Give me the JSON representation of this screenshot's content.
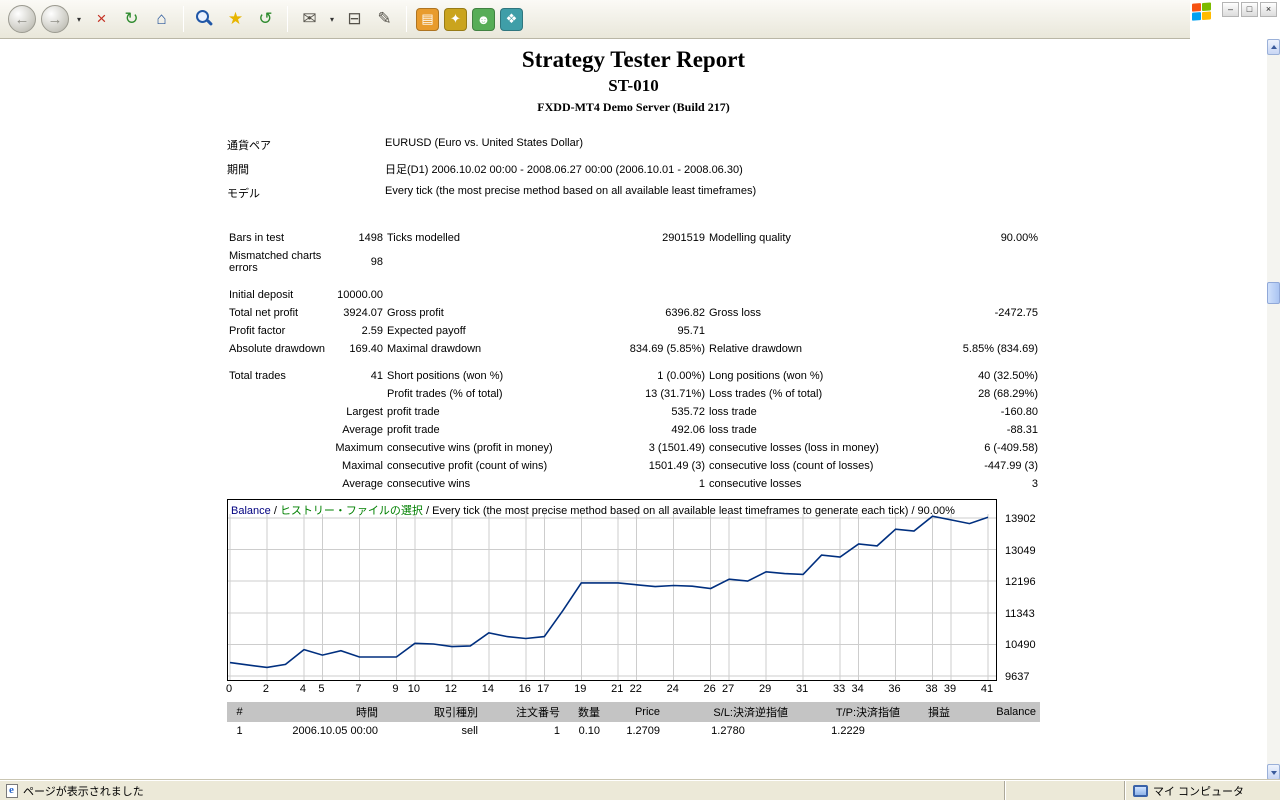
{
  "browser": {
    "toolbar": [
      {
        "name": "back-button",
        "icon": "back-icon",
        "glyph": "←",
        "style": "st-round"
      },
      {
        "name": "forward-button",
        "icon": "forward-icon",
        "glyph": "→",
        "style": "st-round"
      },
      {
        "name": "forward-dropdown",
        "icon": "chevron-down-icon",
        "glyph": "▾",
        "style": "st-caret"
      },
      {
        "name": "stop-button",
        "icon": "stop-icon",
        "glyph": "×",
        "style": "st-flat",
        "color": "#c43022"
      },
      {
        "name": "refresh-button",
        "icon": "refresh-icon",
        "glyph": "↻",
        "style": "st-flat",
        "color": "#2e8b2e"
      },
      {
        "name": "home-button",
        "icon": "home-icon",
        "glyph": "⌂",
        "style": "st-flat",
        "color": "#28569b"
      },
      {
        "type": "separator"
      },
      {
        "name": "search-button",
        "icon": "search-icon",
        "glyph": "",
        "style": "st-flat"
      },
      {
        "name": "favorites-button",
        "icon": "favorites-star-icon",
        "glyph": "★",
        "style": "st-flat",
        "color": "#e7b500"
      },
      {
        "name": "history-button",
        "icon": "history-icon",
        "glyph": "↺",
        "style": "st-flat",
        "color": "#2e8b2e"
      },
      {
        "type": "separator"
      },
      {
        "name": "mail-button",
        "icon": "mail-icon",
        "glyph": "✉",
        "style": "st-flat",
        "color": "#55524a"
      },
      {
        "name": "mail-dropdown",
        "icon": "chevron-down-icon",
        "glyph": "▾",
        "style": "st-caret"
      },
      {
        "name": "print-button",
        "icon": "print-icon",
        "glyph": "⊟",
        "style": "st-flat",
        "color": "#55524a"
      },
      {
        "name": "edit-button",
        "icon": "edit-icon",
        "glyph": "✎",
        "style": "st-flat",
        "color": "#55524a"
      },
      {
        "type": "separator"
      },
      {
        "name": "app-orange-button",
        "icon": "app-orange-icon",
        "glyph": "▤",
        "style": "st-tile",
        "bg": "#e89b2d"
      },
      {
        "name": "app-gold-button",
        "icon": "app-gold-icon",
        "glyph": "✦",
        "style": "st-tile",
        "bg": "#caa41e"
      },
      {
        "name": "messenger-button",
        "icon": "messenger-icon",
        "glyph": "☻",
        "style": "st-tile",
        "bg": "#57ad57"
      },
      {
        "name": "app-teal-button",
        "icon": "app-teal-icon",
        "glyph": "❖",
        "style": "st-tile",
        "bg": "#3f9ea8"
      }
    ],
    "window": {
      "logo_colors": [
        "#f65314",
        "#7cbb00",
        "#00a1f1",
        "#ffbb00"
      ],
      "controls": [
        {
          "name": "minimize-button",
          "glyph": "–"
        },
        {
          "name": "maximize-button",
          "glyph": "□"
        },
        {
          "name": "close-button",
          "glyph": "×"
        }
      ]
    },
    "statusbar": {
      "left_text": "ページが表示されました",
      "right_text": "マイ コンピュータ"
    }
  },
  "report": {
    "title": "Strategy Tester Report",
    "subtitle": "ST-010",
    "server": "FXDD-MT4 Demo Server (Build 217)",
    "meta": [
      {
        "label": "通貨ペア",
        "value": "EURUSD (Euro vs. United States Dollar)"
      },
      {
        "label": "期間",
        "value": "日足(D1) 2006.10.02 00:00 - 2008.06.27 00:00 (2006.10.01 - 2008.06.30)"
      },
      {
        "label": "モデル",
        "value": "Every tick (the most precise method based on all available least timeframes)"
      }
    ],
    "stats_rows": [
      [
        "Bars in test",
        "1498",
        "Ticks modelled",
        "2901519",
        "Modelling quality",
        "90.00%"
      ],
      [
        "Mismatched charts errors",
        "98",
        "",
        "",
        "",
        ""
      ],
      [],
      [
        "Initial deposit",
        "10000.00",
        "",
        "",
        "",
        ""
      ],
      [
        "Total net profit",
        "3924.07",
        "Gross profit",
        "6396.82",
        "Gross loss",
        "-2472.75"
      ],
      [
        "Profit factor",
        "2.59",
        "Expected payoff",
        "95.71",
        "",
        ""
      ],
      [
        "Absolute drawdown",
        "169.40",
        "Maximal drawdown",
        "834.69 (5.85%)",
        "Relative drawdown",
        "5.85% (834.69)"
      ],
      [],
      [
        "Total trades",
        "41",
        "Short positions (won %)",
        "1 (0.00%)",
        "Long positions (won %)",
        "40 (32.50%)"
      ],
      [
        "",
        "",
        "Profit trades (% of total)",
        "13 (31.71%)",
        "Loss trades (% of total)",
        "28 (68.29%)"
      ],
      [
        "",
        "Largest",
        "profit trade",
        "535.72",
        "loss trade",
        "-160.80"
      ],
      [
        "",
        "Average",
        "profit trade",
        "492.06",
        "loss trade",
        "-88.31"
      ],
      [
        "",
        "Maximum",
        "consecutive wins (profit in money)",
        "3 (1501.49)",
        "consecutive losses (loss in money)",
        "6 (-409.58)"
      ],
      [
        "",
        "Maximal",
        "consecutive profit (count of wins)",
        "1501.49 (3)",
        "consecutive loss (count of losses)",
        "-447.99 (3)"
      ],
      [
        "",
        "Average",
        "consecutive wins",
        "1",
        "consecutive losses",
        "3"
      ]
    ]
  },
  "chart_data": {
    "type": "line",
    "title_parts": [
      {
        "text": "Balance",
        "color": "#000080"
      },
      {
        "text": " / ",
        "color": "#000000"
      },
      {
        "text": "ヒストリー・ファイルの選択",
        "color": "#008000"
      },
      {
        "text": " / Every tick (the most precise method based on all available least timeframes to generate each tick) / 90.00%",
        "color": "#000000"
      }
    ],
    "series": [
      {
        "name": "Balance",
        "color": "#002f7f",
        "values": [
          10000,
          9930,
          9870,
          9950,
          10350,
          10200,
          10320,
          10150,
          10150,
          10150,
          10520,
          10500,
          10430,
          10450,
          10800,
          10700,
          10650,
          10700,
          11400,
          12150,
          12150,
          12150,
          12100,
          12050,
          12080,
          12060,
          12000,
          12250,
          12200,
          12450,
          12400,
          12380,
          12900,
          12850,
          13200,
          13150,
          13600,
          13550,
          13950,
          13850,
          13750,
          13924
        ]
      }
    ],
    "x_ticks": [
      0,
      2,
      4,
      5,
      7,
      9,
      10,
      12,
      14,
      16,
      17,
      19,
      21,
      22,
      24,
      26,
      27,
      29,
      31,
      33,
      34,
      36,
      38,
      39,
      41
    ],
    "y_ticks": [
      13902,
      13049,
      12196,
      11343,
      10490,
      9637
    ],
    "xlim": [
      0,
      41
    ],
    "ylim": [
      9637,
      13902
    ],
    "grid": true,
    "legend_position": "top-left-caption"
  },
  "trades": {
    "headers": [
      "#",
      "時間",
      "取引種別",
      "注文番号",
      "数量",
      "Price",
      "S/L:決済逆指値",
      "T/P:決済指値",
      "損益",
      "Balance"
    ],
    "rows": [
      [
        "1",
        "2006.10.05 00:00",
        "sell",
        "1",
        "0.10",
        "1.2709",
        "1.2780",
        "1.2229",
        "",
        ""
      ]
    ]
  }
}
